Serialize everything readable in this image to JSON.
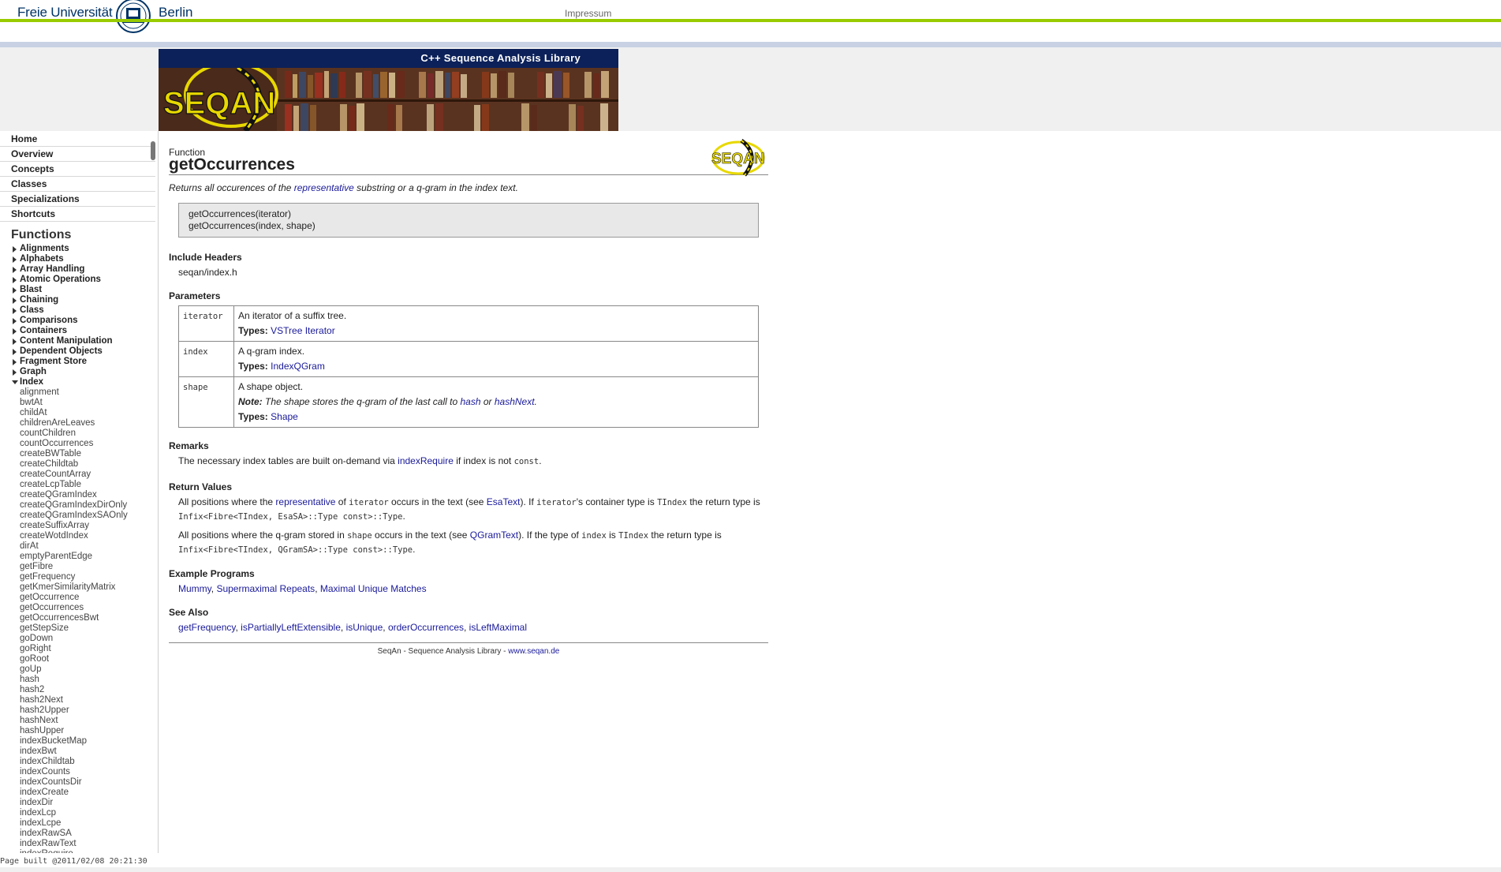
{
  "header": {
    "logo_left": "Freie Universität",
    "logo_right": "Berlin",
    "impressum": "Impressum"
  },
  "banner": {
    "title": "C++ Sequence Analysis Library",
    "logo_text": "SEQAN"
  },
  "sidebar": {
    "main_items": [
      "Home",
      "Overview",
      "Concepts",
      "Classes",
      "Specializations",
      "Shortcuts"
    ],
    "functions_heading": "Functions",
    "categories": [
      {
        "label": "Alignments",
        "expanded": false
      },
      {
        "label": "Alphabets",
        "expanded": false
      },
      {
        "label": "Array Handling",
        "expanded": false
      },
      {
        "label": "Atomic Operations",
        "expanded": false
      },
      {
        "label": "Blast",
        "expanded": false
      },
      {
        "label": "Chaining",
        "expanded": false
      },
      {
        "label": "Class",
        "expanded": false
      },
      {
        "label": "Comparisons",
        "expanded": false
      },
      {
        "label": "Containers",
        "expanded": false
      },
      {
        "label": "Content Manipulation",
        "expanded": false
      },
      {
        "label": "Dependent Objects",
        "expanded": false
      },
      {
        "label": "Fragment Store",
        "expanded": false
      },
      {
        "label": "Graph",
        "expanded": false
      },
      {
        "label": "Index",
        "expanded": true
      }
    ],
    "index_functions": [
      "alignment",
      "bwtAt",
      "childAt",
      "childrenAreLeaves",
      "countChildren",
      "countOccurrences",
      "createBWTable",
      "createChildtab",
      "createCountArray",
      "createLcpTable",
      "createQGramIndex",
      "createQGramIndexDirOnly",
      "createQGramIndexSAOnly",
      "createSuffixArray",
      "createWotdIndex",
      "dirAt",
      "emptyParentEdge",
      "getFibre",
      "getFrequency",
      "getKmerSimilarityMatrix",
      "getOccurrence",
      "getOccurrences",
      "getOccurrencesBwt",
      "getStepSize",
      "goDown",
      "goRight",
      "goRoot",
      "goUp",
      "hash",
      "hash2",
      "hash2Next",
      "hash2Upper",
      "hashNext",
      "hashUpper",
      "indexBucketMap",
      "indexBwt",
      "indexChildtab",
      "indexCounts",
      "indexCountsDir",
      "indexCreate",
      "indexDir",
      "indexLcp",
      "indexLcpe",
      "indexRawSA",
      "indexRawText",
      "indexRequire"
    ],
    "page_built": "Page built @2011/02/08 20:21:30"
  },
  "content": {
    "kind": "Function",
    "title": "getOccurrences",
    "summary_pre": "Returns all occurences of the ",
    "summary_link": "representative",
    "summary_post": " substring or a q-gram in the index text.",
    "signatures": [
      "getOccurrences(iterator)",
      "getOccurrences(index, shape)"
    ],
    "include_heading": "Include Headers",
    "include_file": "seqan/index.h",
    "params_heading": "Parameters",
    "types_label": "Types:",
    "note_label": "Note:",
    "params": [
      {
        "name": "iterator",
        "desc": "An iterator of a suffix tree.",
        "types": "VSTree Iterator"
      },
      {
        "name": "index",
        "desc": "A q-gram index.",
        "types": "IndexQGram"
      },
      {
        "name": "shape",
        "desc": "A shape object.",
        "note_pre": " The shape stores the q-gram of the last call to ",
        "note_link1": "hash",
        "note_mid": " or ",
        "note_link2": "hashNext",
        "note_post": ".",
        "types": "Shape"
      }
    ],
    "remarks_heading": "Remarks",
    "remarks_pre": "The necessary index tables are built on-demand via ",
    "remarks_link": "indexRequire",
    "remarks_mid": " if index is not ",
    "remarks_code": "const",
    "remarks_post": ".",
    "return_heading": "Return Values",
    "return1": {
      "t1": "All positions where the ",
      "link1": "representative",
      "t2": " of ",
      "c1": "iterator",
      "t3": " occurs in the text (see ",
      "link2": "EsaText",
      "t4": "). If ",
      "c2": "iterator",
      "t5": "'s container type is ",
      "c3": "TIndex",
      "t6": " the return type is ",
      "c4": "Infix<Fibre<TIndex, EsaSA>::Type const>::Type",
      "t7": "."
    },
    "return2": {
      "t1": "All positions where the q-gram stored in ",
      "c1": "shape",
      "t2": " occurs in the text (see ",
      "link1": "QGramText",
      "t3": "). If the type of ",
      "c2": "index",
      "t4": " is ",
      "c3": "TIndex",
      "t5": " the return type is ",
      "c4": "Infix<Fibre<TIndex, QGramSA>::Type const>::Type",
      "t6": "."
    },
    "examples_heading": "Example Programs",
    "examples": [
      "Mummy",
      "Supermaximal Repeats",
      "Maximal Unique Matches"
    ],
    "see_also_heading": "See Also",
    "see_also": [
      "getFrequency",
      "isPartiallyLeftExtensible",
      "isUnique",
      "orderOccurrences",
      "isLeftMaximal"
    ],
    "footer_text": "SeqAn - Sequence Analysis Library - ",
    "footer_link": "www.seqan.de"
  },
  "colors": {
    "fu_green": "#99cc00",
    "banner_navy": "#0c2159",
    "link_blue": "#1a1a9a",
    "seqan_yellow": "#e8d800"
  }
}
